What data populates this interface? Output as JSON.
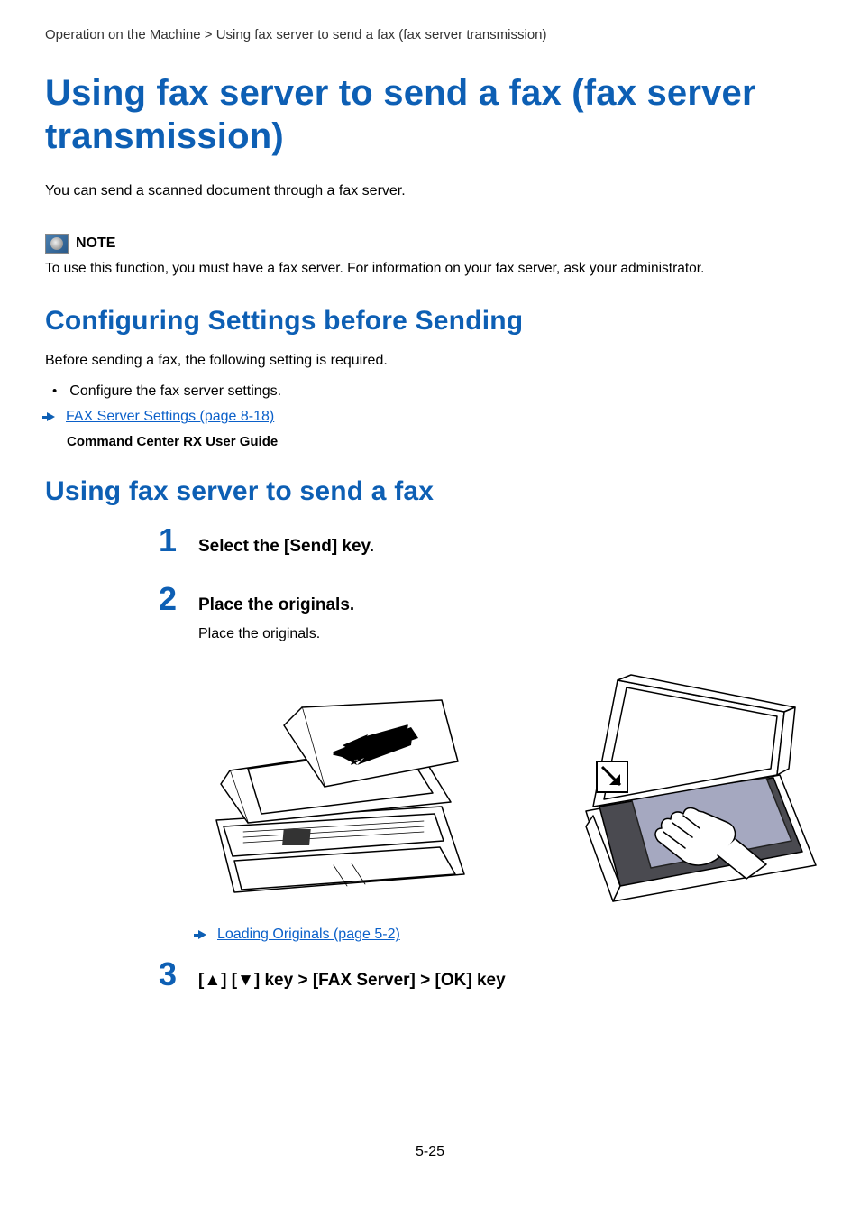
{
  "breadcrumb": "Operation on the Machine > Using fax server to send a fax (fax server transmission)",
  "h1": "Using fax server to send a fax (fax server transmission)",
  "intro": "You can send a scanned document through a fax server.",
  "note": {
    "label": "NOTE",
    "text": "To use this function, you must have a fax server. For information on your fax server, ask your administrator."
  },
  "section1": {
    "heading": "Configuring Settings before Sending",
    "intro": "Before sending a fax, the following setting is required.",
    "bullet": "Configure the fax server settings.",
    "link": "FAX Server Settings (page 8-18)",
    "bold": "Command Center RX User Guide"
  },
  "section2": {
    "heading": "Using fax server to send a fax",
    "steps": [
      {
        "num": "1",
        "title": "Select the [Send] key."
      },
      {
        "num": "2",
        "title": "Place the originals.",
        "body": "Place the originals."
      },
      {
        "num": "3",
        "title": "[▲] [▼] key > [FAX Server] > [OK] key"
      }
    ],
    "step2link": "Loading Originals (page 5-2)"
  },
  "pageNumber": "5-25"
}
